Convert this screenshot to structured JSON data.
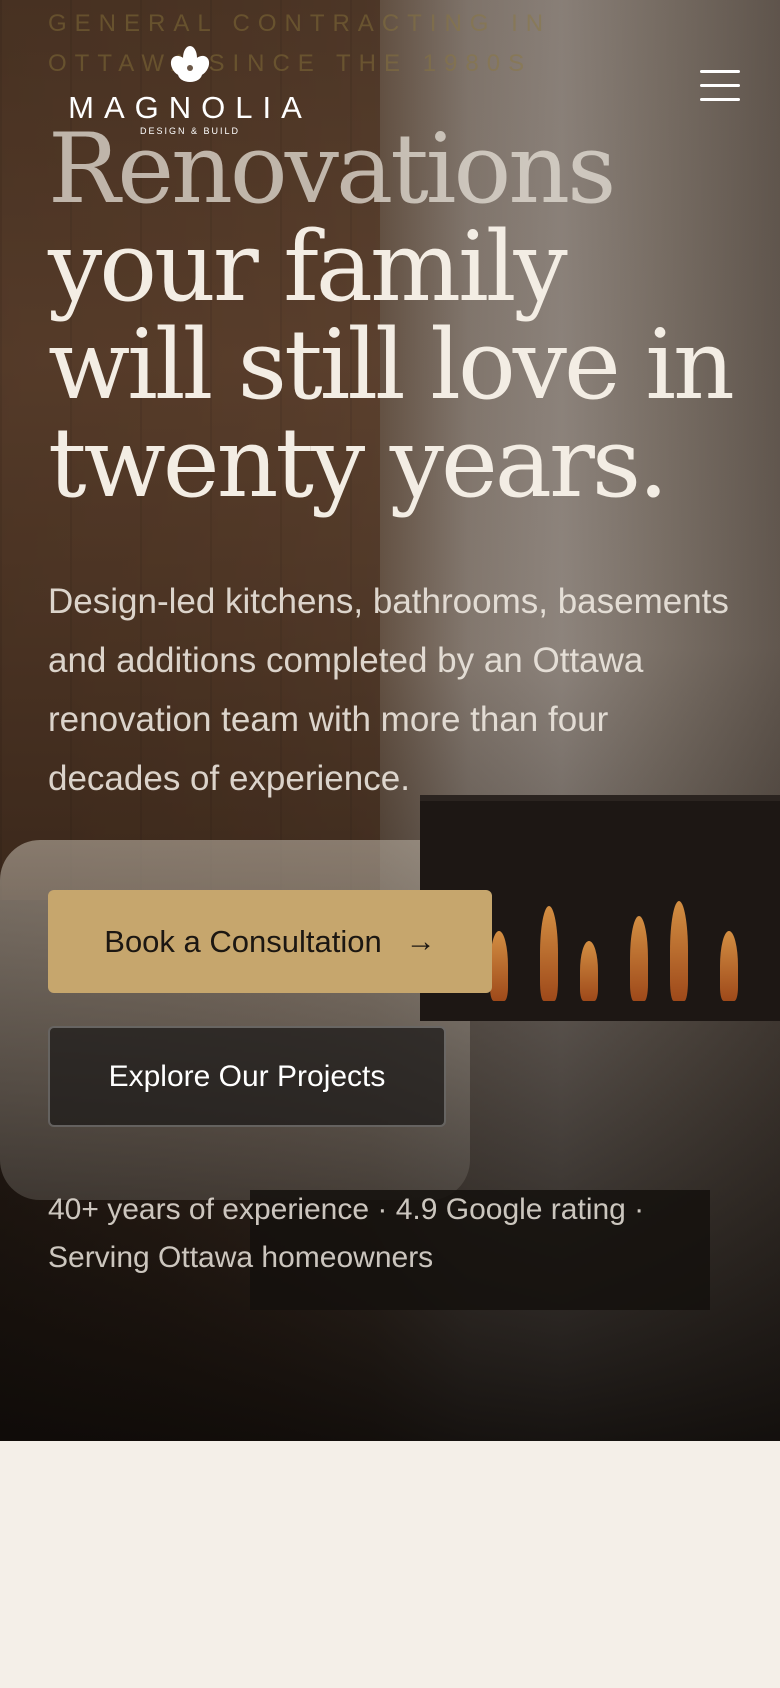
{
  "hero": {
    "eyebrow": "General Contracting in Ottawa since the 1980s",
    "headline_faded": "Renovations",
    "headline_rest": "your family will still love in twenty years.",
    "lead": "Design-led kitchens, bathrooms, basements and additions completed by an Ottawa renovation team with more than four decades of experience.",
    "primary_cta": "Book a Consultation",
    "secondary_cta": "Explore Our Projects",
    "trust_line": "40+ years of experience · 4.9 Google rating · Serving Ottawa homeowners"
  },
  "brand": {
    "name": "MAGNOLIA",
    "tagline": "DESIGN & BUILD",
    "accent": "#c6a66d",
    "page_bg": "#f4efe8"
  },
  "icons": {
    "menu": "hamburger-menu-icon",
    "arrow": "arrow-right-icon",
    "logo": "magnolia-flower-icon"
  }
}
